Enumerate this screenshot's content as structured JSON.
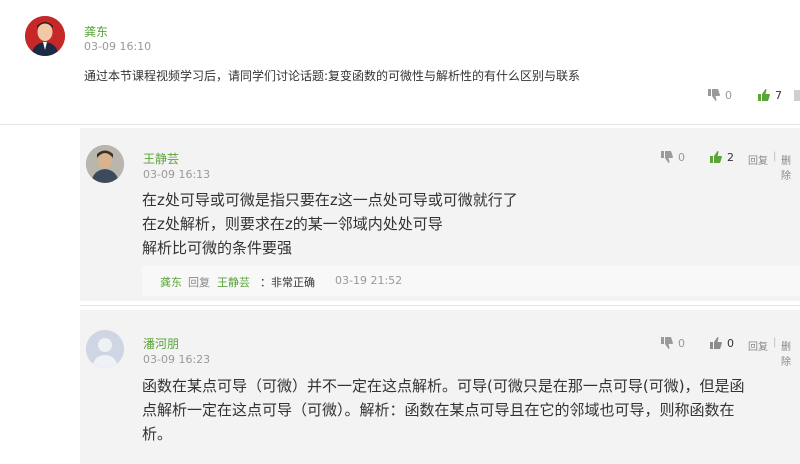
{
  "post": {
    "author": "龚东",
    "time": "03-09 16:10",
    "text": "通过本节课程视频学习后，请同学们讨论话题:复变函数的可微性与解析性的有什么区别与联系",
    "down_count": "0",
    "up_count": "7"
  },
  "replies": [
    {
      "author": "王静芸",
      "time": "03-09 16:13",
      "lines": [
        "在z处可导或可微是指只要在z这一点处可导或可微就行了",
        "在z处解析，则要求在z的某一邻域内处处可导",
        "解析比可微的条件要强"
      ],
      "down_count": "0",
      "up_count": "2",
      "reply_label": "回复",
      "delete_label": "删除",
      "sub_reply": {
        "author": "龚东",
        "verb": "回复",
        "target": "王静芸",
        "text": "：非常正确",
        "time": "03-19 21:52"
      }
    },
    {
      "author": "潘河朋",
      "time": "03-09 16:23",
      "lines": [
        "函数在某点可导（可微）并不一定在这点解析。可导(可微只是在那一点可导(可微)，但是函",
        "点解析一定在这点可导（可微）。解析：函数在某点可导且在它的邻域也可导，则称函数在",
        "析。"
      ],
      "down_count": "0",
      "up_count": "0",
      "reply_label": "回复",
      "delete_label": "删除"
    }
  ],
  "colors": {
    "name_green": "#5aa43a",
    "reply_bg": "#f3f3f3",
    "sub_reply_bg": "#f7f7f7"
  }
}
